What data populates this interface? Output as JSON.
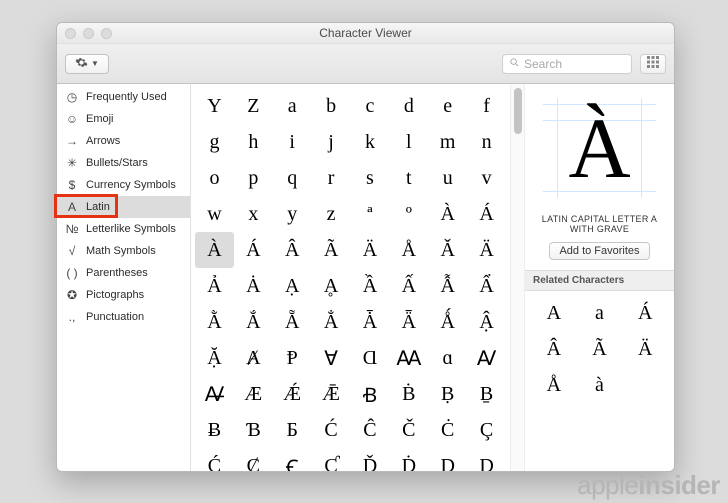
{
  "window": {
    "title": "Character Viewer"
  },
  "toolbar": {
    "search_placeholder": "Search"
  },
  "sidebar": {
    "items": [
      {
        "icon": "clock",
        "label": "Frequently Used"
      },
      {
        "icon": "emoji",
        "label": "Emoji"
      },
      {
        "icon": "arrow",
        "label": "Arrows"
      },
      {
        "icon": "star",
        "label": "Bullets/Stars"
      },
      {
        "icon": "currency",
        "label": "Currency Symbols"
      },
      {
        "icon": "latin",
        "label": "Latin"
      },
      {
        "icon": "letter",
        "label": "Letterlike Symbols"
      },
      {
        "icon": "math",
        "label": "Math Symbols"
      },
      {
        "icon": "paren",
        "label": "Parentheses"
      },
      {
        "icon": "picto",
        "label": "Pictographs"
      },
      {
        "icon": "punct",
        "label": "Punctuation"
      }
    ],
    "selected_index": 5
  },
  "grid": {
    "rows": [
      [
        "Y",
        "Z",
        "a",
        "b",
        "c",
        "d",
        "e",
        "f"
      ],
      [
        "g",
        "h",
        "i",
        "j",
        "k",
        "l",
        "m",
        "n"
      ],
      [
        "o",
        "p",
        "q",
        "r",
        "s",
        "t",
        "u",
        "v"
      ],
      [
        "w",
        "x",
        "y",
        "z",
        "ª",
        "º",
        "À",
        "Á"
      ],
      [
        "À",
        "Á",
        "Â",
        "Ã",
        "Ä",
        "Å",
        "Ǎ",
        "Ä"
      ],
      [
        "Ả",
        "Ȧ",
        "Ạ",
        "Ḁ",
        "Ầ",
        "Ấ",
        "Ẫ",
        "Ẩ"
      ],
      [
        "Ằ",
        "Ắ",
        "Ẵ",
        "Ẳ",
        "Ǡ",
        "Ǟ",
        "Ǻ",
        "Ậ"
      ],
      [
        "Ặ",
        "Ⱥ",
        "Ᵽ",
        "Ɐ",
        "Ɑ",
        "Ꜳ",
        "ɑ",
        "Ꜹ"
      ],
      [
        "Ꜻ",
        "Æ",
        "Ǽ",
        "Ǣ",
        "Ꞗ",
        "Ḃ",
        "Ḅ",
        "Ḇ"
      ],
      [
        "Ƀ",
        "Ɓ",
        "Ƃ",
        "Ć",
        "Ĉ",
        "Č",
        "Ċ",
        "Ç"
      ],
      [
        "Ḉ",
        "Ȼ",
        "Ꞓ",
        "Ƈ",
        "Ď",
        "Ḋ",
        "Ḑ",
        "Ḍ"
      ]
    ],
    "selected_row": 4,
    "selected_col": 0
  },
  "detail": {
    "glyph": "À",
    "name": "LATIN CAPITAL LETTER A WITH GRAVE",
    "favorite_label": "Add to Favorites",
    "related_heading": "Related Characters",
    "related": [
      "A",
      "a",
      "Á",
      "Â",
      "Ã",
      "Ä",
      "Å",
      "à"
    ]
  },
  "watermark": {
    "a": "apple",
    "b": "insider"
  }
}
